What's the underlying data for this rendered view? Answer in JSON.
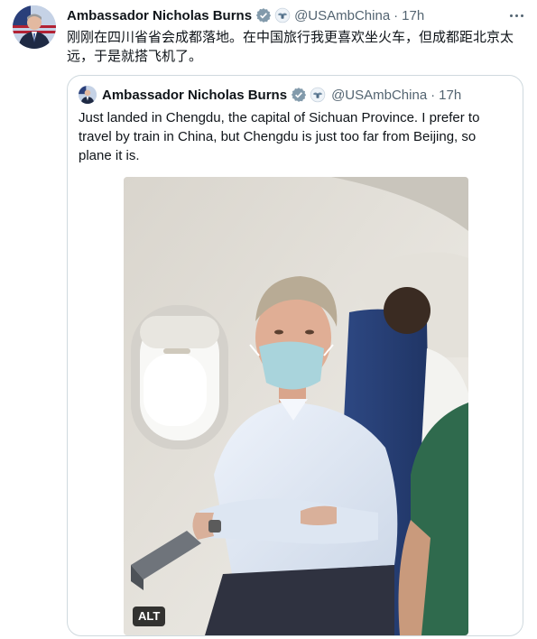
{
  "tweet": {
    "author_name": "Ambassador Nicholas Burns",
    "handle": "@USAmbChina",
    "separator": "·",
    "time": "17h",
    "text_line1": "刚刚在四川省省会成都落地。在中国旅行我更喜欢坐火车，但成都距北京太",
    "text_line2": "远，于是就搭飞机了。",
    "avatar_icon": "profile-photo",
    "verified_icon": "verified-badge-icon",
    "verified_color": "#1d9bf0",
    "affiliate_icon": "us-government-seal-icon"
  },
  "quoted": {
    "author_name": "Ambassador Nicholas Burns",
    "handle": "@USAmbChina",
    "separator": "·",
    "time": "17h",
    "text_line1": "Just landed in Chengdu, the capital of Sichuan Province.  I prefer to",
    "text_line2": "travel by train in China, but Chengdu is just too far from Beijing, so",
    "text_line3": "plane it is.",
    "photo": {
      "subject": "man in light blue shirt and face mask seated by airplane window",
      "alt_badge": "ALT"
    }
  },
  "colors": {
    "text": "#0f1419",
    "secondary": "#536471",
    "border": "#cfd9de"
  }
}
